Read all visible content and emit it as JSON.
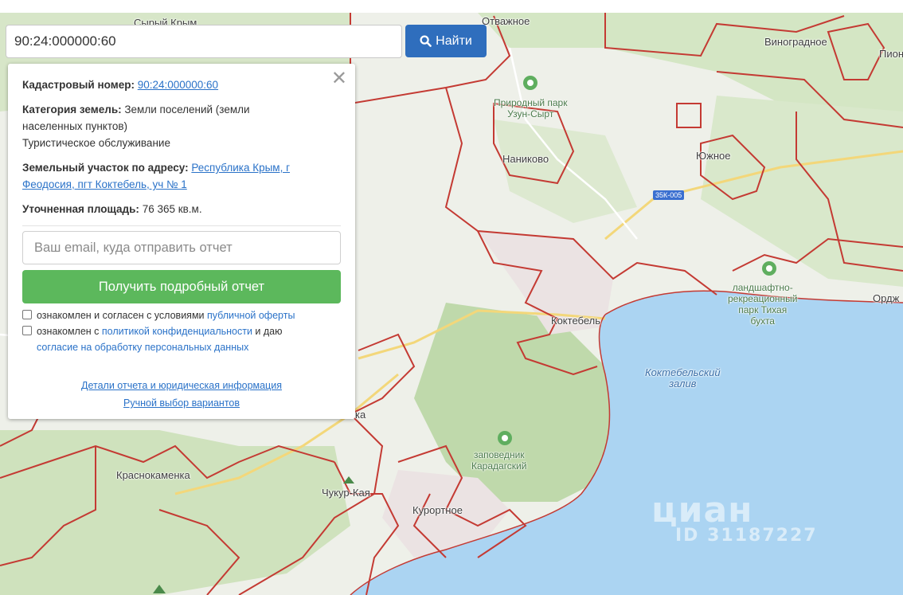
{
  "search": {
    "value": "90:24:000000:60",
    "button_label": "Найти",
    "icon": "search-icon"
  },
  "card": {
    "close_icon": "close-icon",
    "cadastral_label": "Кадастровый номер:",
    "cadastral_value": "90:24:000000:60",
    "category_label": "Категория земель:",
    "category_value": "Земли поселений (земли",
    "category_value_2": "населенных пунктов)",
    "category_purpose": "Туристическое обслуживание",
    "address_label": "Земельный участок по адресу:",
    "address_value_1": "Республика Крым, г",
    "address_value_2": "Феодосия, пгт Коктебель, уч № 1",
    "area_label": "Уточненная площадь:",
    "area_value": "76 365 кв.м.",
    "email_placeholder": "Ваш email, куда отправить отчет",
    "report_button": "Получить подробный отчет",
    "consent_1_text": "ознакомлен и согласен с условиями ",
    "consent_1_link": "публичной оферты",
    "consent_2_text": "ознакомлен с ",
    "consent_2_link": "политикой конфиденциальности",
    "consent_2_text_b": " и даю",
    "consent_2_link_b": "согласие на обработку персональных данных",
    "details_link": "Детали отчета и юридическая информация",
    "manual_link": "Ручной выбор вариантов"
  },
  "map": {
    "labels": {
      "otvazhnoe": "Отважное",
      "vinogradnoe": "Виноградное",
      "pion": "Пион",
      "park_uzun_1": "Природный парк",
      "park_uzun_2": "Узун-Сырт",
      "nanikovo": "Наниково",
      "yuzhnoe": "Южное",
      "road": "35К-005",
      "park_tikhaya_1": "ландшафтно-",
      "park_tikhaya_2": "рекреационный",
      "park_tikhaya_3": "парк Тихая",
      "park_tikhaya_4": "бухта",
      "ordzh": "Ордж",
      "koktebel": "Коктебель",
      "bay_1": "Коктебельский",
      "bay_2": "залив",
      "karadag_1": "заповедник",
      "karadag_2": "Карадагский",
      "krasnokamenka": "Краснокаменка",
      "chukur": "Чукур-Кая",
      "kurortnoe": "Курортное",
      "ka": "ка",
      "top_left": "Сырый Крым"
    },
    "watermark": "циан",
    "watermark_id": "ID 31187227"
  },
  "colors": {
    "land": "#eef0e9",
    "forest": "#cfe3bf",
    "sea": "#abd4f2",
    "boundary": "#c43a33",
    "button": "#2f6ebd",
    "report": "#5cb85c"
  }
}
